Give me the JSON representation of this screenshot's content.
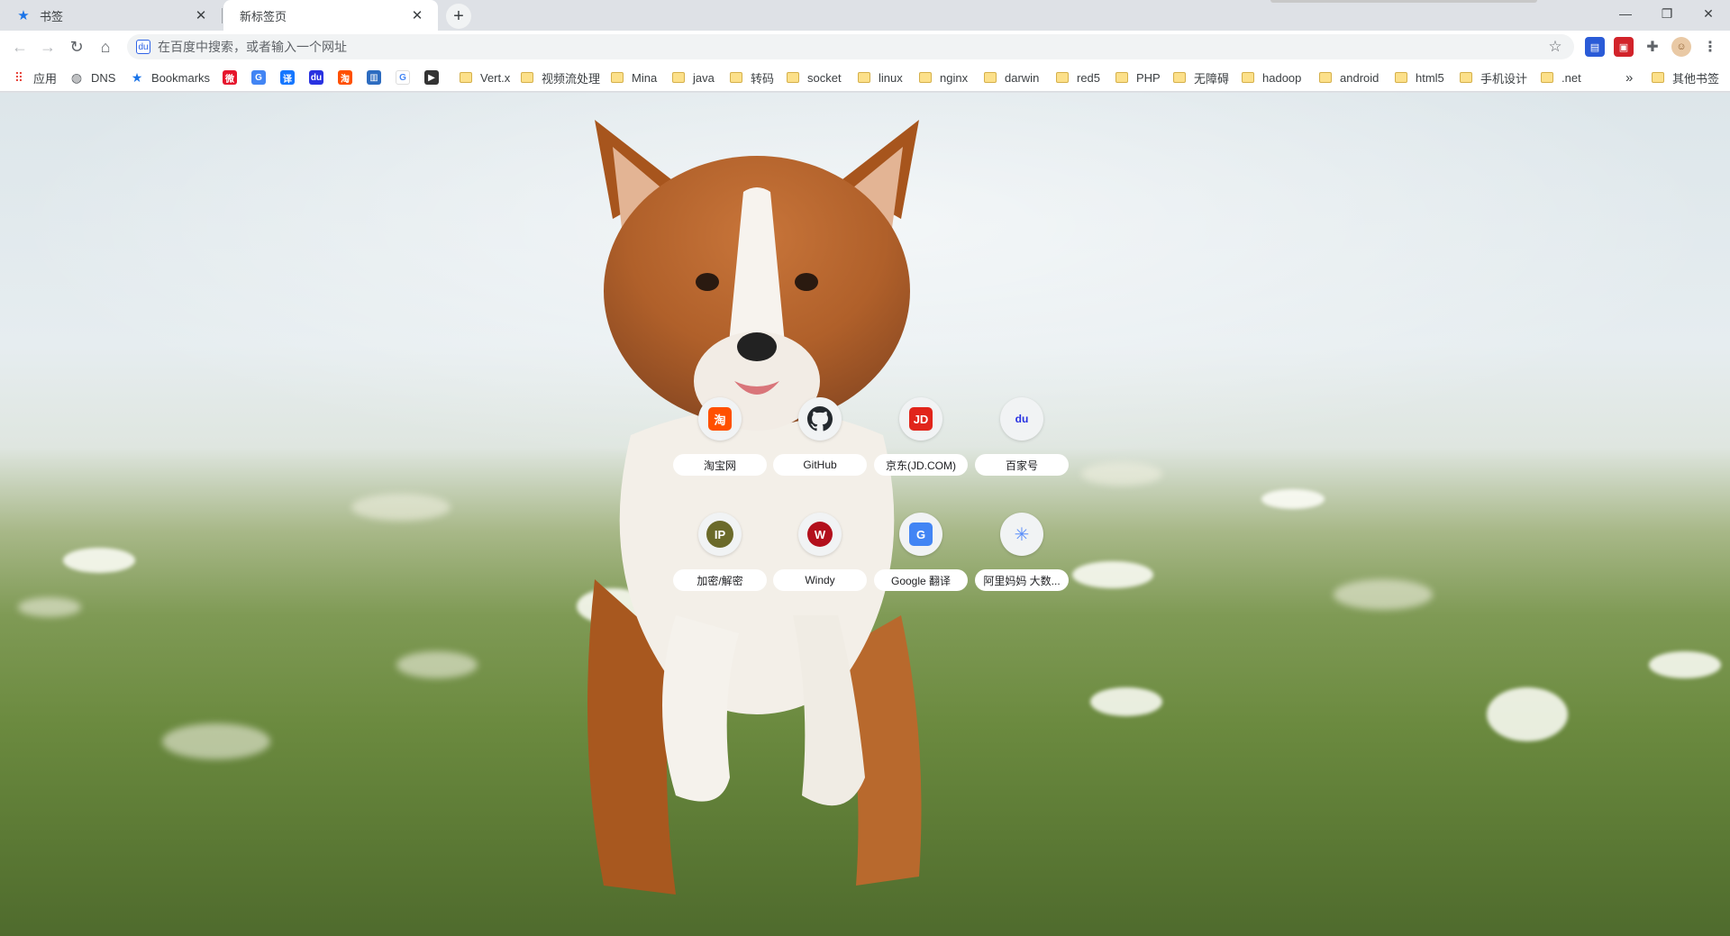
{
  "tabs": [
    {
      "title": "书签",
      "icon": "star-icon"
    },
    {
      "title": "新标签页",
      "icon": "none"
    }
  ],
  "window_controls": {
    "minimize": "minimize-icon",
    "restore": "restore-icon",
    "close": "close-icon"
  },
  "toolbar": {
    "omnibox_placeholder": "在百度中搜索，或者输入一个网址",
    "search_engine_icon": "baidu-icon"
  },
  "bookmarks": {
    "apps_label": "应用",
    "items": [
      {
        "label": "DNS",
        "icon": "globe-icon"
      },
      {
        "label": "Bookmarks",
        "icon": "star-icon"
      },
      {
        "label": "",
        "icon": "weibo-icon"
      },
      {
        "label": "",
        "icon": "google-translate-icon"
      },
      {
        "label": "",
        "icon": "translate-icon"
      },
      {
        "label": "",
        "icon": "baidu-icon"
      },
      {
        "label": "",
        "icon": "taobao-icon"
      },
      {
        "label": "",
        "icon": "chart-icon"
      },
      {
        "label": "",
        "icon": "google-icon"
      },
      {
        "label": "",
        "icon": "media-icon"
      }
    ],
    "folders": [
      "Vert.x",
      "视频流处理",
      "Mina",
      "java",
      "转码",
      "socket",
      "linux",
      "nginx",
      "darwin",
      "red5",
      "PHP",
      "无障碍",
      "hadoop",
      "android",
      "html5",
      "手机设计",
      ".net"
    ],
    "overflow_label": "»",
    "other_label": "其他书签"
  },
  "shortcuts": [
    {
      "label": "淘宝网",
      "icon": "taobao-icon",
      "glyph": "淘",
      "color": "#ff5000"
    },
    {
      "label": "GitHub",
      "icon": "github-icon",
      "glyph": "",
      "color": "#24292e"
    },
    {
      "label": "京东(JD.COM)",
      "icon": "jd-icon",
      "glyph": "JD",
      "color": "#e1251b"
    },
    {
      "label": "百家号",
      "icon": "baidu-paw-icon",
      "glyph": "du",
      "color": "#2932e1"
    },
    {
      "label": "加密/解密",
      "icon": "ip-icon",
      "glyph": "IP",
      "color": "#6b6a2a"
    },
    {
      "label": "Windy",
      "icon": "windy-icon",
      "glyph": "W",
      "color": "#b3101c"
    },
    {
      "label": "Google 翻译",
      "icon": "google-translate-icon",
      "glyph": "G",
      "color": "#4285f4"
    },
    {
      "label": "阿里妈妈 大数...",
      "icon": "alimama-icon",
      "glyph": "✳",
      "color": "#5b8ff9"
    }
  ]
}
